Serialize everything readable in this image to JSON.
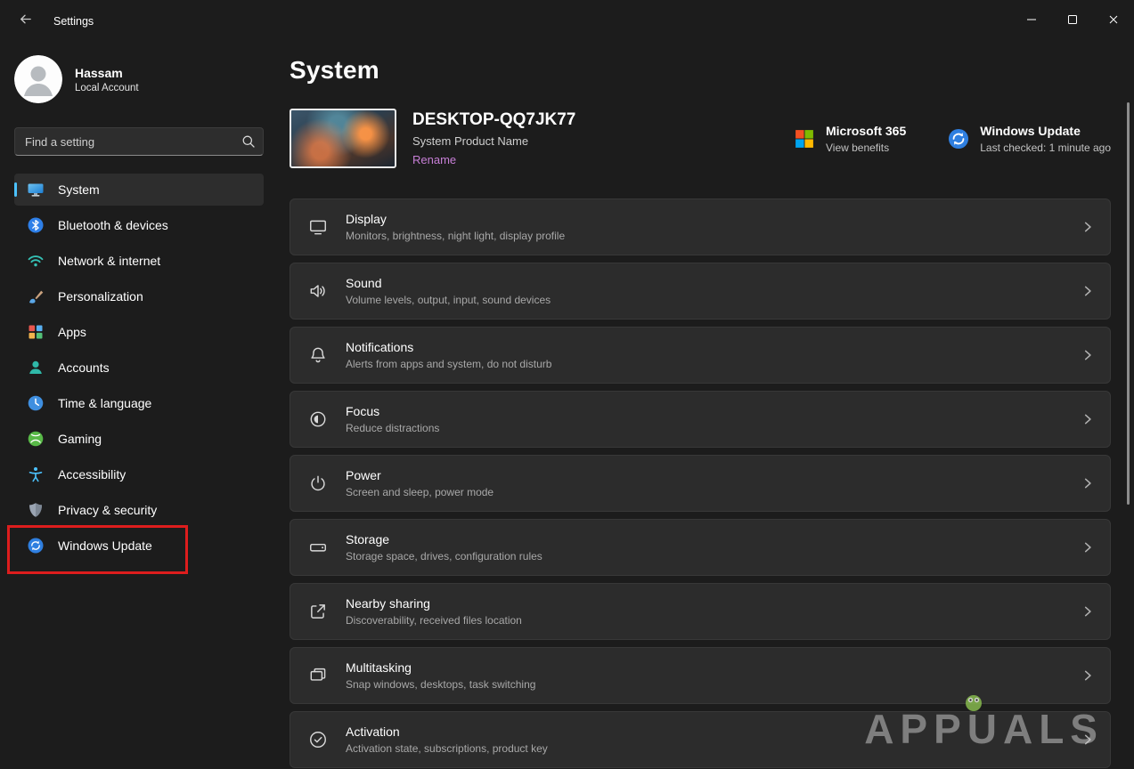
{
  "titlebar": {
    "title": "Settings"
  },
  "sidebar": {
    "user": {
      "name": "Hassam",
      "account_type": "Local Account"
    },
    "search_placeholder": "Find a setting",
    "items": [
      {
        "label": "System",
        "icon": "system-icon",
        "selected": true
      },
      {
        "label": "Bluetooth & devices",
        "icon": "bluetooth-icon"
      },
      {
        "label": "Network & internet",
        "icon": "network-icon"
      },
      {
        "label": "Personalization",
        "icon": "personalization-icon"
      },
      {
        "label": "Apps",
        "icon": "apps-icon"
      },
      {
        "label": "Accounts",
        "icon": "accounts-icon"
      },
      {
        "label": "Time & language",
        "icon": "time-language-icon"
      },
      {
        "label": "Gaming",
        "icon": "gaming-icon"
      },
      {
        "label": "Accessibility",
        "icon": "accessibility-icon"
      },
      {
        "label": "Privacy & security",
        "icon": "privacy-icon"
      },
      {
        "label": "Windows Update",
        "icon": "windows-update-icon",
        "highlighted_by_annotation": true
      }
    ]
  },
  "main": {
    "page_title": "System",
    "device": {
      "name": "DESKTOP-QQ7JK77",
      "product_name": "System Product Name",
      "rename_label": "Rename"
    },
    "quick_links": {
      "microsoft_365": {
        "title": "Microsoft 365",
        "subtitle": "View benefits",
        "icon": "microsoft-365-icon"
      },
      "windows_update": {
        "title": "Windows Update",
        "subtitle": "Last checked: 1 minute ago",
        "icon": "windows-update-icon"
      }
    },
    "rows": [
      {
        "title": "Display",
        "subtitle": "Monitors, brightness, night light, display profile",
        "icon": "display-icon"
      },
      {
        "title": "Sound",
        "subtitle": "Volume levels, output, input, sound devices",
        "icon": "sound-icon"
      },
      {
        "title": "Notifications",
        "subtitle": "Alerts from apps and system, do not disturb",
        "icon": "notifications-icon"
      },
      {
        "title": "Focus",
        "subtitle": "Reduce distractions",
        "icon": "focus-icon"
      },
      {
        "title": "Power",
        "subtitle": "Screen and sleep, power mode",
        "icon": "power-icon"
      },
      {
        "title": "Storage",
        "subtitle": "Storage space, drives, configuration rules",
        "icon": "storage-icon"
      },
      {
        "title": "Nearby sharing",
        "subtitle": "Discoverability, received files location",
        "icon": "nearby-sharing-icon"
      },
      {
        "title": "Multitasking",
        "subtitle": "Snap windows, desktops, task switching",
        "icon": "multitasking-icon"
      },
      {
        "title": "Activation",
        "subtitle": "Activation state, subscriptions, product key",
        "icon": "activation-icon"
      }
    ]
  },
  "watermark": {
    "text": "APPUALS"
  },
  "colors": {
    "accent": "#4cc2ff",
    "rename_link": "#c77fd6",
    "annotation": "#dd1d1d",
    "card": "#2c2c2c",
    "background": "#1c1c1c"
  }
}
